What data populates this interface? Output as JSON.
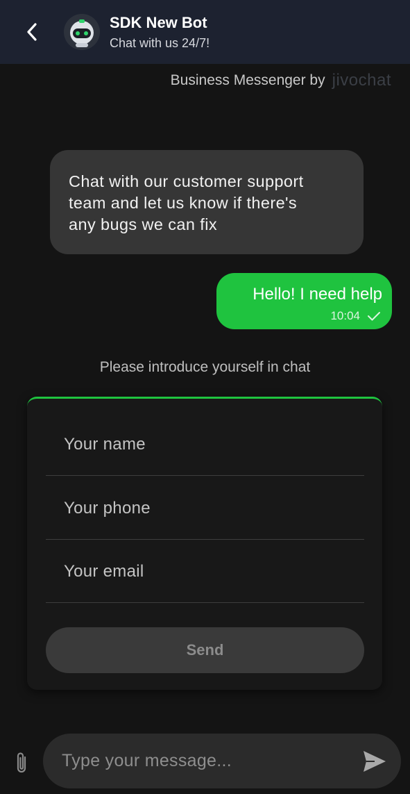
{
  "header": {
    "back_icon": "chevron-left-icon",
    "avatar_icon": "robot-icon",
    "bot_name": "SDK New Bot",
    "bot_status": "Chat with us 24/7!"
  },
  "branding": {
    "text": "Business Messenger by",
    "logo": "jivochat"
  },
  "messages": [
    {
      "direction": "incoming",
      "lines": [
        "Chat with our customer support",
        "team and let us know if there's",
        "any bugs we can fix"
      ]
    },
    {
      "direction": "outgoing",
      "text": "Hello! I need help",
      "time": "10:04",
      "status_icon": "check-icon"
    }
  ],
  "intro_form": {
    "prompt": "Please introduce yourself in chat",
    "name_placeholder": "Your name",
    "phone_placeholder": "Your phone",
    "email_placeholder": "Your email",
    "send_label": "Send"
  },
  "composer": {
    "attach_icon": "paperclip-icon",
    "placeholder": "Type your message...",
    "send_icon": "send-icon"
  },
  "colors": {
    "accent": "#1fc33f",
    "header_bg": "#1d2230",
    "page_bg": "#141414",
    "incoming_bubble": "#363636"
  }
}
